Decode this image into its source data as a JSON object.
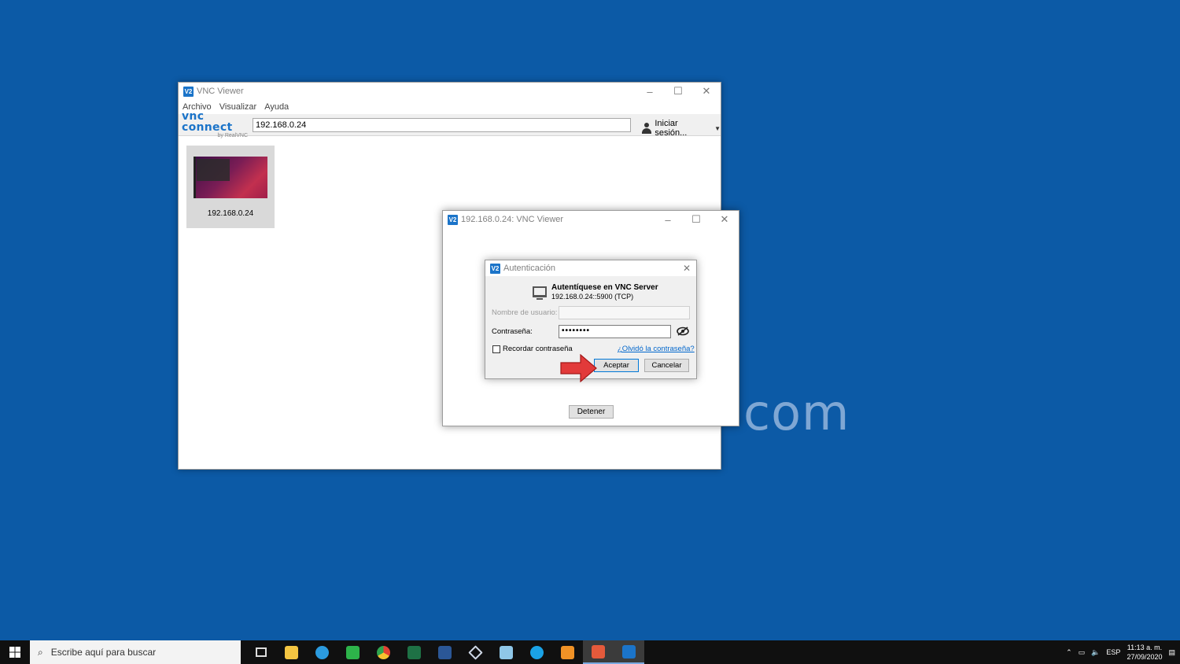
{
  "desktop": {
    "watermark": "com"
  },
  "main_window": {
    "title": "VNC Viewer",
    "logo_icon": "vnc-logo-icon",
    "controls": [
      "minimize",
      "maximize",
      "close"
    ],
    "menu": [
      "Archivo",
      "Visualizar",
      "Ayuda"
    ],
    "brand": {
      "name": "vnc connect",
      "by": "by RealVNC"
    },
    "address": "192.168.0.24",
    "signin_label": "Iniciar sesión...",
    "thumbnail_label": "192.168.0.24"
  },
  "connection_window": {
    "title": "192.168.0.24: VNC Viewer",
    "stop_button": "Detener"
  },
  "auth_dialog": {
    "title": "Autenticación",
    "heading": "Autentíquese en VNC Server",
    "server": "192.168.0.24::5900 (TCP)",
    "username_label": "Nombre de usuario:",
    "username_value": "",
    "password_label": "Contraseña:",
    "password_value": "••••••••",
    "remember_label": "Recordar contraseña",
    "remember_checked": false,
    "forgot_link": "¿Olvidó la contraseña?",
    "ok_button": "Aceptar",
    "cancel_button": "Cancelar"
  },
  "taskbar": {
    "search_placeholder": "Escribe aquí para buscar",
    "apps": [
      "task-view",
      "file-explorer",
      "edge",
      "camtasia",
      "chrome",
      "excel",
      "word",
      "virtualbox",
      "notepad",
      "skype",
      "app-orange",
      "recorder",
      "vnc-viewer"
    ],
    "language": "ESP",
    "time": "11:13 a. m.",
    "date": "27/09/2020"
  },
  "colors": {
    "desktop": "#0c5aa6",
    "vnc_blue": "#1b74c9",
    "arrow_red": "#e23a3a"
  }
}
